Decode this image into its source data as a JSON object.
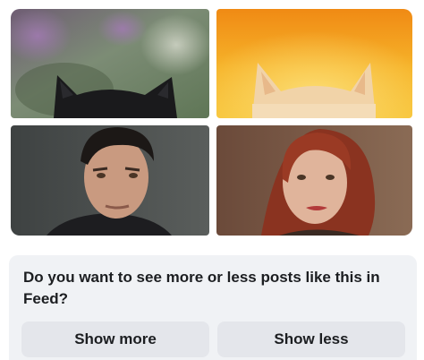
{
  "feedback": {
    "question": "Do you want to see more or less posts like this in Feed?",
    "show_more_label": "Show more",
    "show_less_label": "Show less"
  },
  "images": [
    {
      "id": "tile-black-cat",
      "icon": "black-cat-ears-image"
    },
    {
      "id": "tile-orange-cat",
      "icon": "orange-cat-ears-image"
    },
    {
      "id": "tile-man-portrait",
      "icon": "man-portrait-image"
    },
    {
      "id": "tile-woman-portrait",
      "icon": "woman-portrait-image"
    }
  ],
  "colors": {
    "card_background": "#f0f2f5",
    "button_background": "#e4e6eb",
    "text_primary": "#1c1e21"
  }
}
